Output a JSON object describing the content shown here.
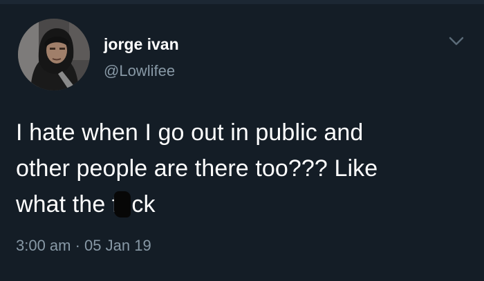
{
  "tweet": {
    "author": {
      "display_name": "jorge ivan",
      "handle": "@Lowlifee"
    },
    "text": {
      "line1": "I hate when I go out in public and",
      "line2": "other people are there too??? Like",
      "line3_start": "what the f",
      "line3_end": "ck"
    },
    "timestamp": "3:00 am · 05 Jan 19"
  },
  "icons": {
    "avatar": "avatar-photo",
    "menu": "chevron-down-icon",
    "censor": "censor-blot"
  },
  "colors": {
    "background": "#141d26",
    "text_primary": "#ffffff",
    "text_secondary": "#8899a6"
  }
}
